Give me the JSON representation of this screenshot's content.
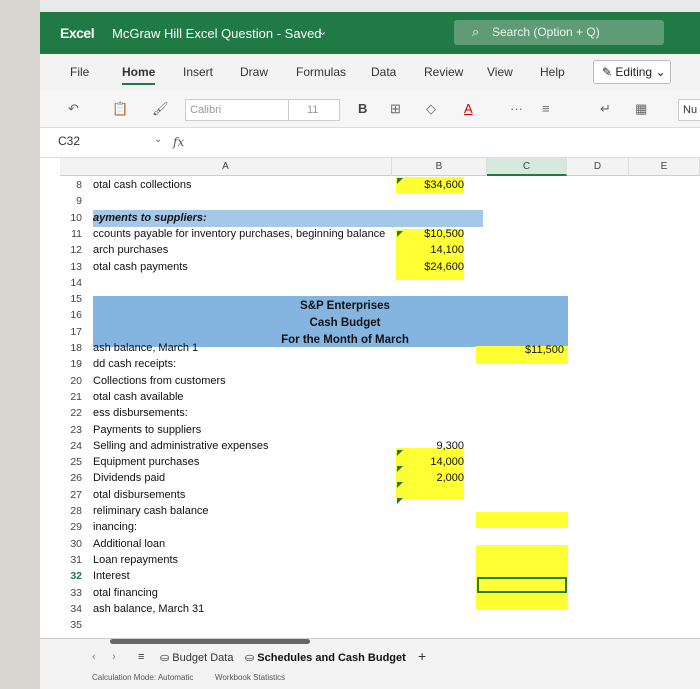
{
  "titlebar": {
    "app": "Excel",
    "doc_title": "McGraw Hill Excel Question",
    "saved": "- Saved",
    "search_placeholder": "Search (Option + Q)"
  },
  "tabs": [
    "File",
    "Home",
    "Insert",
    "Draw",
    "Formulas",
    "Data",
    "Review",
    "View",
    "Help"
  ],
  "active_tab": "Home",
  "editing_label": "Editing",
  "toolbar": {
    "font_name": "Calibri",
    "font_size": "11",
    "number_format": "Nu"
  },
  "formula_bar": {
    "name_box": "C32",
    "fx_label": "fx"
  },
  "columns": [
    "A",
    "B",
    "C",
    "D",
    "E"
  ],
  "rows": [
    {
      "n": "8",
      "a": "otal cash collections",
      "b": "$34,600"
    },
    {
      "n": "9",
      "a": "",
      "b": ""
    },
    {
      "n": "10",
      "a": "ayments to suppliers:",
      "b": ""
    },
    {
      "n": "11",
      "a": "ccounts payable for inventory purchases, beginning balance",
      "b": "$10,500"
    },
    {
      "n": "12",
      "a": "arch purchases",
      "b": "14,100"
    },
    {
      "n": "13",
      "a": "otal cash payments",
      "b": "$24,600"
    },
    {
      "n": "14",
      "a": "",
      "b": ""
    },
    {
      "n": "15",
      "a": "",
      "b": ""
    },
    {
      "n": "16",
      "a": "",
      "b": ""
    },
    {
      "n": "17",
      "a": "",
      "b": ""
    },
    {
      "n": "18",
      "a": "ash balance, March 1",
      "b": "",
      "c": "$11,500"
    },
    {
      "n": "19",
      "a": "dd cash receipts:",
      "b": ""
    },
    {
      "n": "20",
      "a": "Collections from customers",
      "b": ""
    },
    {
      "n": "21",
      "a": "otal cash available",
      "b": ""
    },
    {
      "n": "22",
      "a": "ess disbursements:",
      "b": ""
    },
    {
      "n": "23",
      "a": "Payments to suppliers",
      "b": ""
    },
    {
      "n": "24",
      "a": "Selling and administrative expenses",
      "b": "9,300"
    },
    {
      "n": "25",
      "a": "Equipment purchases",
      "b": "14,000"
    },
    {
      "n": "26",
      "a": "Dividends paid",
      "b": "2,000"
    },
    {
      "n": "27",
      "a": "otal disbursements",
      "b": ""
    },
    {
      "n": "28",
      "a": "reliminary cash balance",
      "b": ""
    },
    {
      "n": "29",
      "a": "inancing:",
      "b": ""
    },
    {
      "n": "30",
      "a": "Additional loan",
      "b": ""
    },
    {
      "n": "31",
      "a": "Loan repayments",
      "b": ""
    },
    {
      "n": "32",
      "a": "Interest",
      "b": ""
    },
    {
      "n": "33",
      "a": "otal financing",
      "b": ""
    },
    {
      "n": "34",
      "a": "ash balance, March 31",
      "b": ""
    },
    {
      "n": "35",
      "a": "",
      "b": ""
    }
  ],
  "budget_heading": {
    "line1": "S&P Enterprises",
    "line2": "Cash Budget",
    "line3": "For the Month of March"
  },
  "sheets": [
    "Budget Data",
    "Schedules and Cash Budget"
  ],
  "active_sheet": "Schedules and Cash Budget",
  "status": {
    "calc_mode": "Calculation Mode: Automatic",
    "workbook_stats": "Workbook Statistics"
  },
  "colors": {
    "excel_green": "#1f7a45",
    "header_blue": "#5b9bd5",
    "input_yellow": "#ffff33"
  }
}
